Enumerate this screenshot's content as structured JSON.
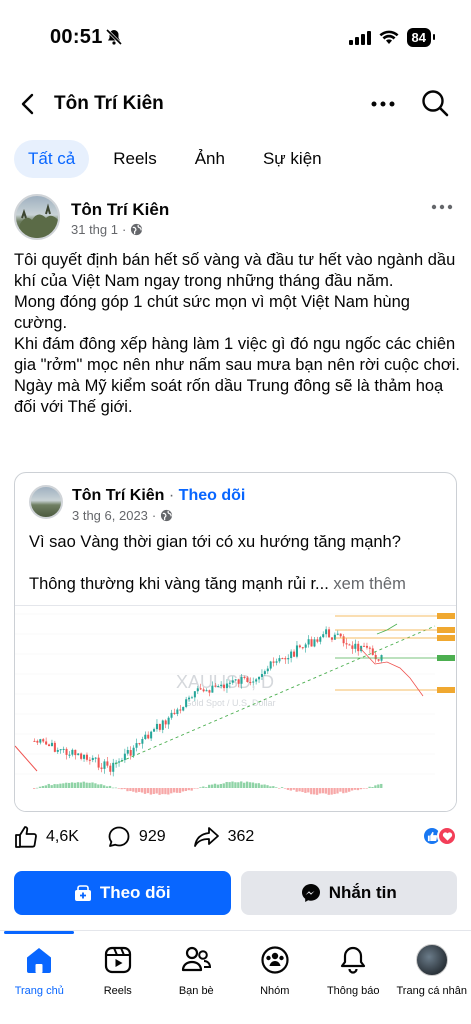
{
  "status": {
    "time": "00:51",
    "battery": "84"
  },
  "header": {
    "title": "Tôn Trí Kiên"
  },
  "filters": [
    {
      "label": "Tất cả",
      "active": true
    },
    {
      "label": "Reels"
    },
    {
      "label": "Ảnh"
    },
    {
      "label": "Sự kiện"
    }
  ],
  "post": {
    "author": "Tôn Trí Kiên",
    "date": "31 thg 1",
    "dot": "·",
    "text": "Tôi quyết định bán hết số vàng và đầu tư hết vào ngành dầu khí của Việt Nam ngay trong những tháng đầu năm.\nMong đóng góp 1 chút sức mọn vì một Việt Nam hùng cường.\nKhi đám đông xếp hàng làm 1 việc gì đó ngu ngốc các chiên gia \"rởm\" mọc nên như nấm sau mưa  bạn nên rời cuộc chơi.\nNgày mà Mỹ kiểm soát rốn dầu Trung đông sẽ là thảm hoạ đối với Thế giới."
  },
  "shared": {
    "author": "Tôn Trí Kiên",
    "separator": " · ",
    "follow": "Theo dõi",
    "date": "3 thg 6, 2023",
    "dot": "·",
    "line1": "Vì sao Vàng thời gian tới có xu hướng tăng mạnh?",
    "line2": "Thông thường khi vàng tăng mạnh rủi r...",
    "see_more": "xem thêm",
    "chart_watermark": "XAUUSD, D",
    "chart_watermark_sub": "Gold Spot / U.S. Dollar"
  },
  "reactions": {
    "likes": "4,6K",
    "comments": "929",
    "shares": "362"
  },
  "buttons": {
    "follow": "Theo dõi",
    "message": "Nhắn tin"
  },
  "nav": [
    {
      "label": "Trang chủ",
      "icon": "home-icon",
      "active": true
    },
    {
      "label": "Reels",
      "icon": "reels-icon"
    },
    {
      "label": "Bạn bè",
      "icon": "friends-icon"
    },
    {
      "label": "Nhóm",
      "icon": "groups-icon"
    },
    {
      "label": "Thông báo",
      "icon": "bell-icon"
    },
    {
      "label": "Trang cá nhân",
      "icon": "profile-icon"
    }
  ],
  "colors": {
    "accent": "#0866ff",
    "like": "#1877f2",
    "love": "#f33e58",
    "chart_up": "#26a69a",
    "chart_down": "#ef5350"
  }
}
